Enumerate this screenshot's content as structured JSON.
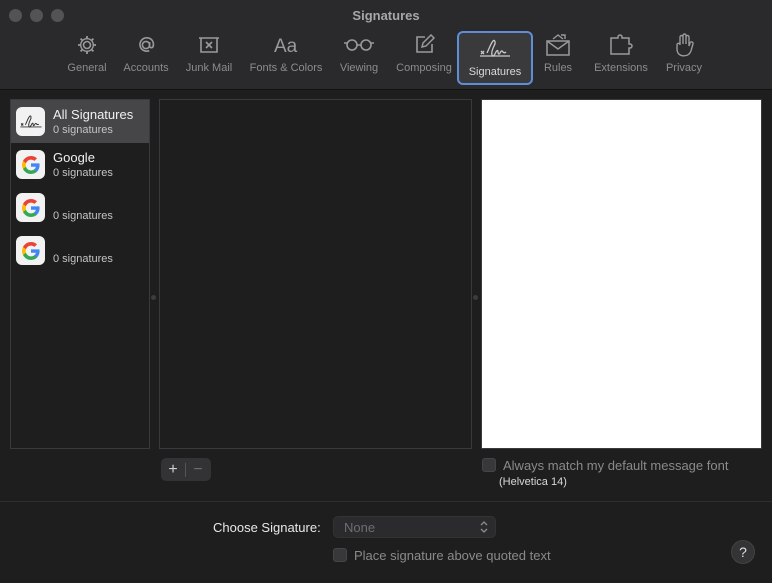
{
  "window": {
    "title": "Signatures"
  },
  "toolbar": {
    "items": [
      {
        "label": "General",
        "icon": "gear-icon"
      },
      {
        "label": "Accounts",
        "icon": "at-sign-icon"
      },
      {
        "label": "Junk Mail",
        "icon": "junk-tray-icon"
      },
      {
        "label": "Fonts & Colors",
        "icon": "text-aa-icon"
      },
      {
        "label": "Viewing",
        "icon": "glasses-icon"
      },
      {
        "label": "Composing",
        "icon": "pencil-square-icon"
      },
      {
        "label": "Signatures",
        "icon": "signature-icon",
        "selected": true
      },
      {
        "label": "Rules",
        "icon": "envelope-rules-icon"
      },
      {
        "label": "Extensions",
        "icon": "puzzle-icon"
      },
      {
        "label": "Privacy",
        "icon": "hand-icon"
      }
    ]
  },
  "accounts": [
    {
      "name": "All Signatures",
      "count": "0 signatures",
      "icon": "signature-icon"
    },
    {
      "name": "Google",
      "count": "0 signatures",
      "icon": "google-icon"
    },
    {
      "name": "",
      "count": "0 signatures",
      "icon": "google-icon"
    },
    {
      "name": "",
      "count": "0 signatures",
      "icon": "google-icon"
    }
  ],
  "controls": {
    "add_label": "+",
    "remove_label": "−",
    "match_font_label": "Always match my default message font",
    "font_note": "(Helvetica 14)",
    "choose_label": "Choose Signature:",
    "choose_value": "None",
    "place_above_label": "Place signature above quoted text",
    "help_label": "?"
  },
  "colors": {
    "selection_ring": "#5d8ed6",
    "background": "#1e1e1e",
    "preview_bg": "#ffffff"
  }
}
